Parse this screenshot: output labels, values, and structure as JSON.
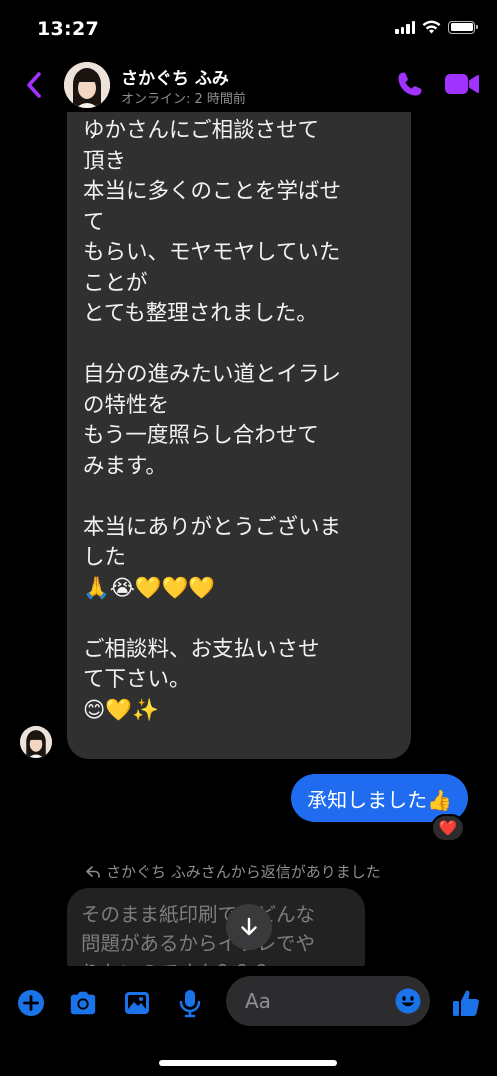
{
  "status_bar": {
    "time": "13:27"
  },
  "header": {
    "contact_name": "さかぐち ふみ",
    "contact_status": "オンライン: 2 時間前"
  },
  "messages": {
    "incoming_text": "ゆかさんにご相談させて\n頂き\n本当に多くのことを学ばせ\nて\nもらい、モヤモヤしていた\nことが\nとても整理されました。\n\n自分の進みたい道とイラレ\nの特性を\nもう一度照らし合わせて\nみます。\n\n本当にありがとうございま\nした\n🙏😭💛💛💛\n\nご相談料、お支払いさせ\nて下さい。\n😊💛✨",
    "outgoing_text": "承知しました👍",
    "reaction": "❤️",
    "reply_note": "さかぐち ふみさんから返信がありました",
    "reply_text": "そのまま紙印刷ではどんな\n問題があるからイラレでや\nりたいのですか？？？"
  },
  "composer": {
    "placeholder": "Aa"
  },
  "colors": {
    "accent": "#a033ff",
    "outgoing_bubble": "#1f6cf0",
    "incoming_bubble": "#303030",
    "composer_icon": "#1a73e8"
  },
  "icons": [
    "back-chevron-icon",
    "phone-icon",
    "video-icon",
    "plus-icon",
    "camera-icon",
    "image-icon",
    "microphone-icon",
    "emoji-icon",
    "thumbs-up-icon",
    "arrow-down-icon",
    "reply-arrow-icon"
  ]
}
